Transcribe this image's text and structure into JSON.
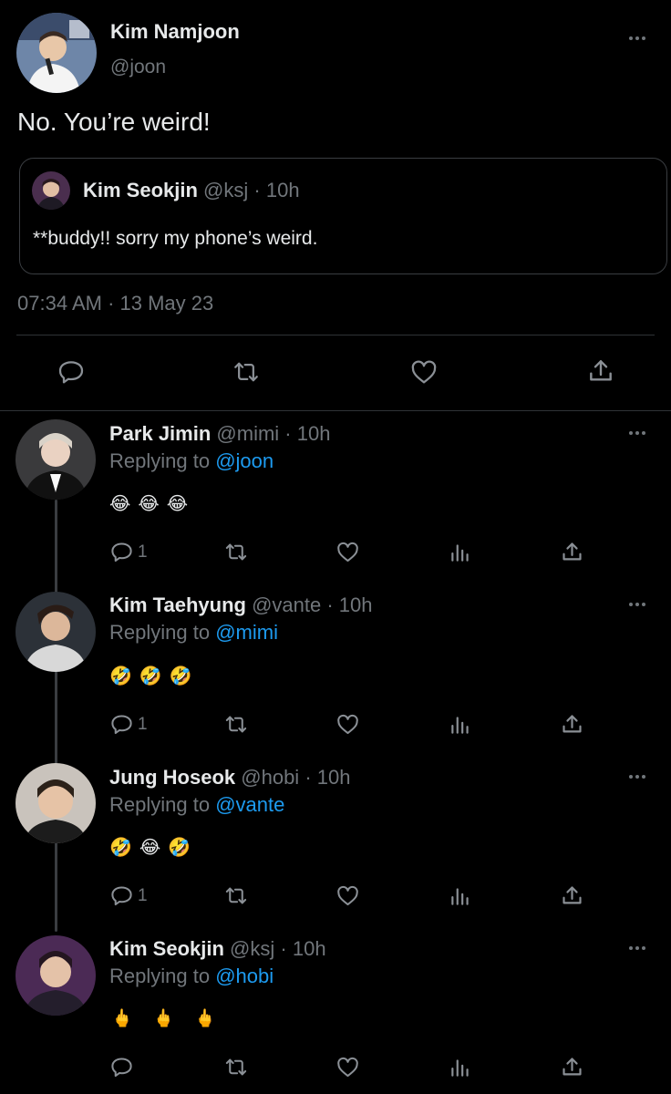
{
  "main_tweet": {
    "author_name": "Kim Namjoon",
    "handle": "@joon",
    "text": "No. You’re weird!",
    "quoted": {
      "author_name": "Kim Seokjin",
      "handle": "@ksj",
      "time": "· 10h",
      "text": "**buddy!! sorry my phone’s weird."
    },
    "timestamp": "07:34 AM · 13 May 23"
  },
  "replies": [
    {
      "author_name": "Park Jimin",
      "handle": "@mimi",
      "time": "· 10h",
      "replying_label": "Replying to",
      "replying_to": "@joon",
      "emojis": [
        "😂",
        "😂",
        "😂"
      ],
      "reply_count": "1"
    },
    {
      "author_name": "Kim Taehyung",
      "handle": "@vante",
      "time": "· 10h",
      "replying_label": "Replying to",
      "replying_to": "@mimi",
      "emojis": [
        "🤣",
        "🤣",
        "🤣"
      ],
      "reply_count": "1"
    },
    {
      "author_name": "Jung Hoseok",
      "handle": "@hobi",
      "time": "· 10h",
      "replying_label": "Replying to",
      "replying_to": "@vante",
      "emojis": [
        "🤣",
        "😂",
        "🤣"
      ],
      "reply_count": "1"
    },
    {
      "author_name": "Kim Seokjin",
      "handle": "@ksj",
      "time": "· 10h",
      "replying_label": "Replying to",
      "replying_to": "@hobi",
      "emojis": [
        "🖕",
        "🖕",
        "🖕"
      ],
      "reply_count": ""
    }
  ],
  "icons": {
    "reply": "speech-bubble-icon",
    "retweet": "retweet-arrows-icon",
    "like": "heart-icon",
    "views": "bar-chart-icon",
    "share": "share-upload-icon",
    "more": "more-dots-icon"
  },
  "colors": {
    "background": "#000000",
    "text": "#e7e9ea",
    "muted": "#71767b",
    "link": "#1d9bf0",
    "border": "#2f3336"
  }
}
